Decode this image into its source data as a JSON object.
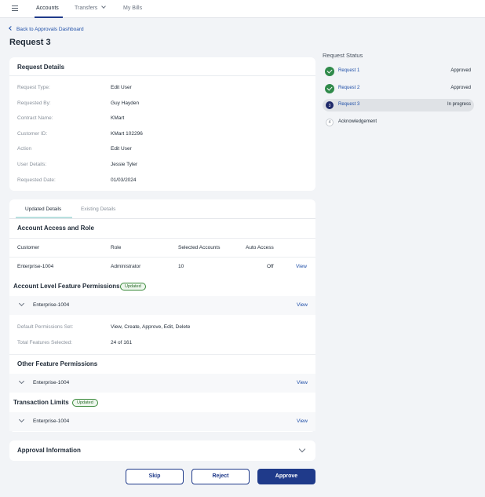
{
  "topnav": {
    "items": [
      "Accounts",
      "Transfers",
      "My Bills"
    ]
  },
  "back_link": "Back to Approvals Dashboard",
  "page_title": "Request 3",
  "request_details": {
    "title": "Request Details",
    "rows": [
      {
        "label": "Request Type:",
        "value": "Edit User"
      },
      {
        "label": "Requested By:",
        "value": "Guy Hayden"
      },
      {
        "label": "Contract Name:",
        "value": "KMart"
      },
      {
        "label": "Customer ID:",
        "value": "KMart 102296"
      },
      {
        "label": "Action",
        "value": "Edit User"
      },
      {
        "label": "User Details:",
        "value": "Jessie Tyler"
      },
      {
        "label": "Requested Date:",
        "value": "01/03/2024"
      }
    ]
  },
  "tabs": [
    "Updated Details",
    "Existing Details"
  ],
  "account_access": {
    "title": "Account Access and Role",
    "headers": [
      "Customer",
      "Role",
      "Selected Accounts",
      "Auto Access"
    ],
    "row": {
      "customer": "Enterprise-1004",
      "role": "Administrator",
      "accounts": "10",
      "auto": "Off",
      "action": "View"
    }
  },
  "account_level": {
    "title": "Account Level Feature Permissions",
    "badge": "Updated",
    "expander_name": "Enterprise-1004",
    "expander_action": "View",
    "default_label": "Default Permissions Set:",
    "default_value": "View, Create, Approve, Edit, Delete",
    "total_label": "Total Features Selected:",
    "total_value": "24 of 161"
  },
  "other_feature": {
    "title": "Other Feature Permissions",
    "expander_name": "Enterprise-1004",
    "expander_action": "View"
  },
  "transaction_limits": {
    "title": "Transaction Limits",
    "badge": "Updated",
    "expander_name": "Enterprise-1004",
    "expander_action": "View"
  },
  "approval_info": {
    "title": "Approval Information"
  },
  "buttons": {
    "skip": "Skip",
    "reject": "Reject",
    "approve": "Approve"
  },
  "request_status": {
    "title": "Request Status",
    "steps": [
      {
        "label": "Request 1",
        "state": "Approved"
      },
      {
        "label": "Request 2",
        "state": "Approved"
      },
      {
        "label": "Request 3",
        "state": "In progress",
        "number": "3"
      },
      {
        "label": "Acknowledgement",
        "state": "",
        "number": "4"
      }
    ]
  },
  "colors": {
    "primary": "#1f3a8a",
    "link": "#1f4fa8",
    "success": "#2f8a4a"
  }
}
